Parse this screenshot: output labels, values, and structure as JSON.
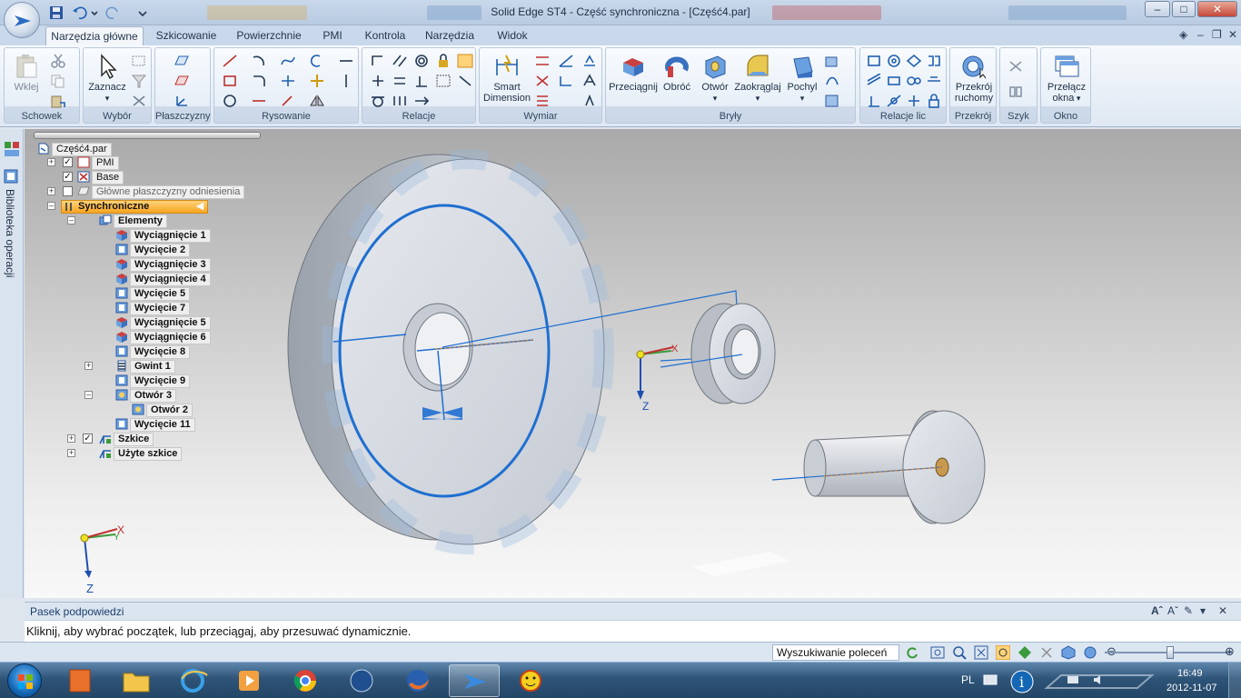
{
  "window": {
    "title": "Solid Edge ST4 - Część synchroniczna - [Część4.par]"
  },
  "ribbon_tabs": [
    {
      "label": "Narzędzia główne",
      "active": true
    },
    {
      "label": "Szkicowanie",
      "active": false
    },
    {
      "label": "Powierzchnie",
      "active": false
    },
    {
      "label": "PMI",
      "active": false
    },
    {
      "label": "Kontrola",
      "active": false
    },
    {
      "label": "Narzędzia",
      "active": false
    },
    {
      "label": "Widok",
      "active": false
    }
  ],
  "ribbon": {
    "schowek": {
      "label": "Schowek",
      "paste": "Wklej"
    },
    "wybor": {
      "label": "Wybór",
      "select": "Zaznacz"
    },
    "plaszczyzny": {
      "label": "Płaszczyzny"
    },
    "rysowanie": {
      "label": "Rysowanie"
    },
    "relacje": {
      "label": "Relacje"
    },
    "wymiar": {
      "label": "Wymiar",
      "smart_line1": "Smart",
      "smart_line2": "Dimension"
    },
    "bryly": {
      "label": "Bryły",
      "extrude": "Przeciągnij",
      "revolve": "Obróć",
      "hole": "Otwór",
      "round": "Zaokrąglaj",
      "draft": "Pochyl"
    },
    "relacje_lic": {
      "label": "Relacje lic"
    },
    "przekroj": {
      "label": "Przekrój",
      "btn_line1": "Przekrój",
      "btn_line2": "ruchomy"
    },
    "szyk": {
      "label": "Szyk"
    },
    "okno": {
      "label": "Okno",
      "btn_line1": "Przełącz",
      "btn_line2": "okna"
    }
  },
  "side_panel": {
    "library_label": "Biblioteka operacji"
  },
  "tree": {
    "root": "Część4.par",
    "nodes": [
      {
        "label": "PMI",
        "bold": false,
        "checked": true,
        "icon": "pmi-icon"
      },
      {
        "label": "Base",
        "bold": false,
        "checked": true,
        "icon": "base-icon"
      },
      {
        "label": "Główne płaszczyzny odniesienia",
        "bold": false,
        "checked": false,
        "icon": "planes-icon"
      },
      {
        "label": "Synchroniczne",
        "bold": true,
        "icon": "sync-icon"
      },
      {
        "label": "Elementy",
        "bold": true,
        "icon": "features-icon"
      },
      {
        "label": "Wyciągnięcie 1",
        "icon": "extrude-icon"
      },
      {
        "label": "Wycięcie 2",
        "icon": "cut-icon"
      },
      {
        "label": "Wyciągnięcie 3",
        "icon": "extrude-icon"
      },
      {
        "label": "Wyciągnięcie 4",
        "icon": "extrude-icon"
      },
      {
        "label": "Wycięcie 5",
        "icon": "cut-icon"
      },
      {
        "label": "Wycięcie 7",
        "icon": "cut-icon"
      },
      {
        "label": "Wyciągnięcie 5",
        "icon": "extrude-icon"
      },
      {
        "label": "Wyciągnięcie 6",
        "icon": "extrude-icon"
      },
      {
        "label": "Wycięcie 8",
        "icon": "cut-icon"
      },
      {
        "label": "Gwint 1",
        "icon": "thread-icon"
      },
      {
        "label": "Wycięcie 9",
        "icon": "cut-icon"
      },
      {
        "label": "Otwór 3",
        "icon": "hole-icon"
      },
      {
        "label": "Otwór 2",
        "icon": "hole-icon"
      },
      {
        "label": "Wycięcie 11",
        "icon": "cut-icon"
      },
      {
        "label": "Szkice",
        "bold": true,
        "checked": true,
        "icon": "sketch-icon"
      },
      {
        "label": "Użyte szkice",
        "bold": true,
        "icon": "sketch-icon"
      }
    ]
  },
  "viewport": {
    "axis_z": "Z",
    "axis_x": "X",
    "axis_y": "Y"
  },
  "hint_bar": {
    "title": "Pasek podpowiedzi",
    "text": "Kliknij, aby wybrać początek, lub przeciągaj, aby przesuwać dynamicznie."
  },
  "status_bar": {
    "command_search": "Wyszukiwanie poleceń"
  },
  "taskbar": {
    "language": "PL",
    "time": "16:49",
    "date": "2012-11-07"
  },
  "colors": {
    "accent": "#1f6fd0",
    "selection": "#f7a420"
  }
}
